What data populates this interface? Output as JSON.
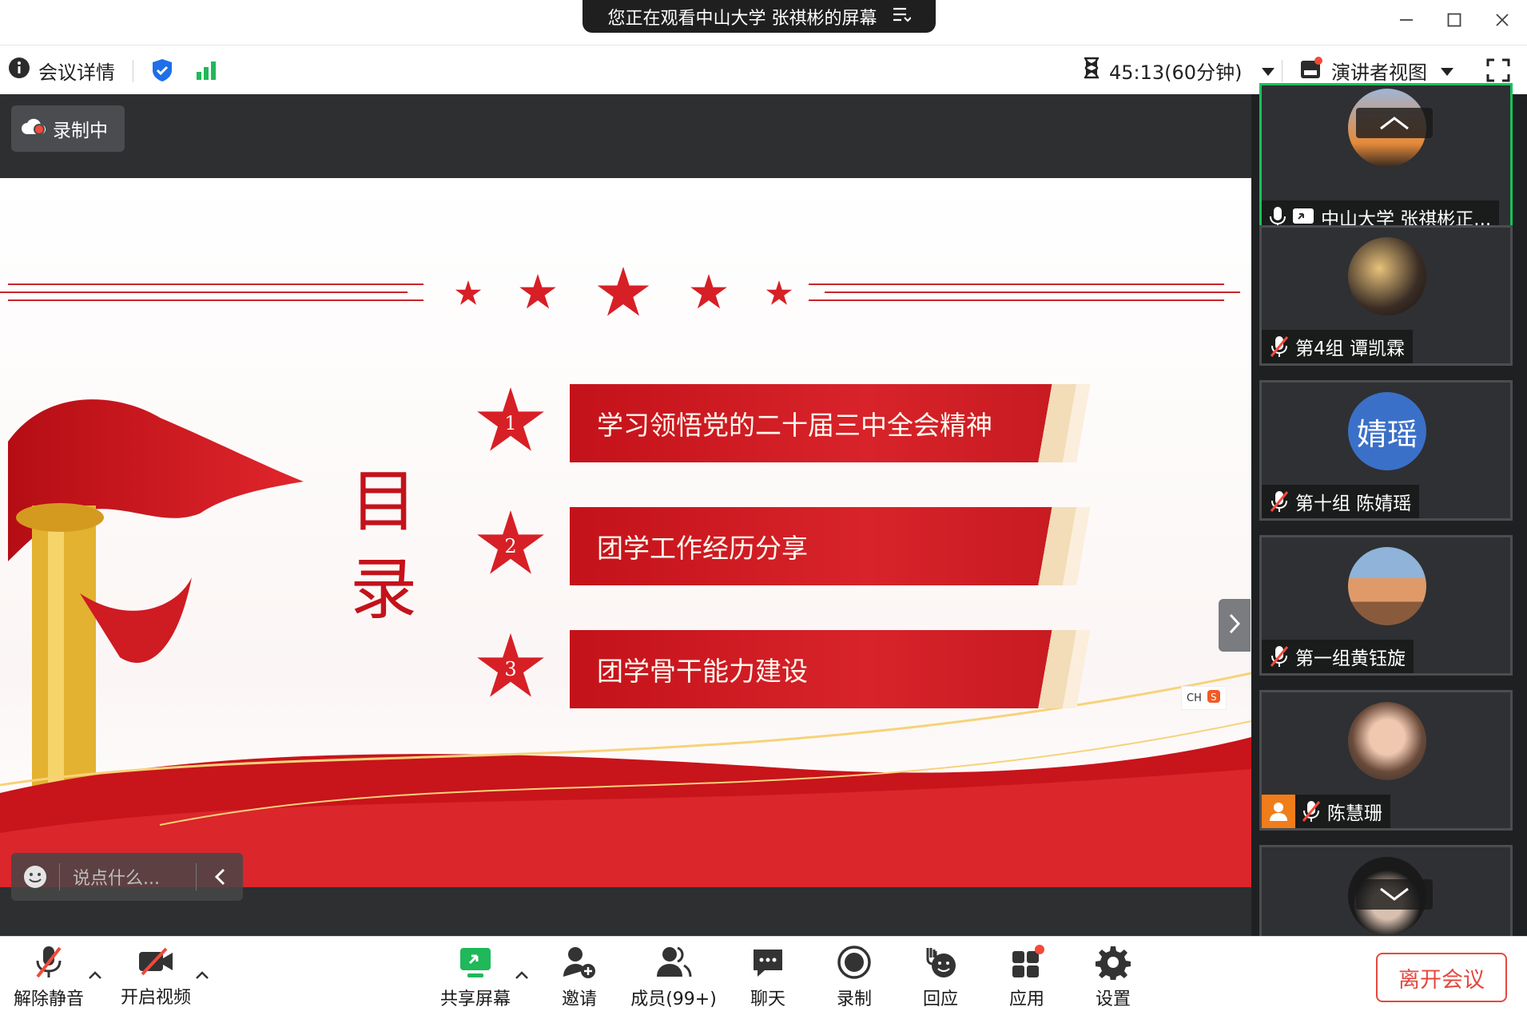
{
  "window": {
    "share_banner": "您正在观看中山大学 张祺彬的屏幕",
    "minimize_icon": "minimize-icon",
    "maximize_icon": "maximize-icon",
    "close_icon": "close-icon"
  },
  "infobar": {
    "meeting_details": "会议详情",
    "timer": "45:13(60分钟)",
    "view_mode": "演讲者视图",
    "colors": {
      "shield": "#1e6fe8",
      "signal": "#1fb85a"
    }
  },
  "stage": {
    "recording_label": "录制中",
    "chat_placeholder": "说点什么...",
    "slide": {
      "title_chars": [
        "目",
        "录"
      ],
      "items": [
        {
          "number": "1",
          "text": "学习领悟党的二十届三中全会精神"
        },
        {
          "number": "2",
          "text": "团学工作经历分享"
        },
        {
          "number": "3",
          "text": "团学骨干能力建设"
        }
      ],
      "ime_indicator": "CH",
      "colors": {
        "primary_red": "#d71f26",
        "gold": "#f2ddb8"
      }
    }
  },
  "sidebar": {
    "participants": [
      {
        "name": "中山大学 张祺彬正...",
        "muted": false,
        "sharing": true,
        "active": true
      },
      {
        "name": "第4组 谭凯霖",
        "muted": true
      },
      {
        "name": "第十组 陈婧瑶",
        "muted": true,
        "avatar_text": "婧瑶",
        "avatar_color": "#3b70c9"
      },
      {
        "name": "第一组黄钰旋",
        "muted": true
      },
      {
        "name": "陈慧珊",
        "muted": true,
        "host_badge": true
      },
      {
        "name": "",
        "muted": true
      }
    ]
  },
  "toolbar": {
    "unmute": "解除静音",
    "start_video": "开启视频",
    "share_screen": "共享屏幕",
    "invite": "邀请",
    "members": "成员(99+)",
    "chat": "聊天",
    "record": "录制",
    "reactions": "回应",
    "apps": "应用",
    "settings": "设置",
    "leave": "离开会议",
    "colors": {
      "share_green": "#1fb85a",
      "leave_red": "#e5483f",
      "badge_red": "#f24a3a"
    }
  }
}
